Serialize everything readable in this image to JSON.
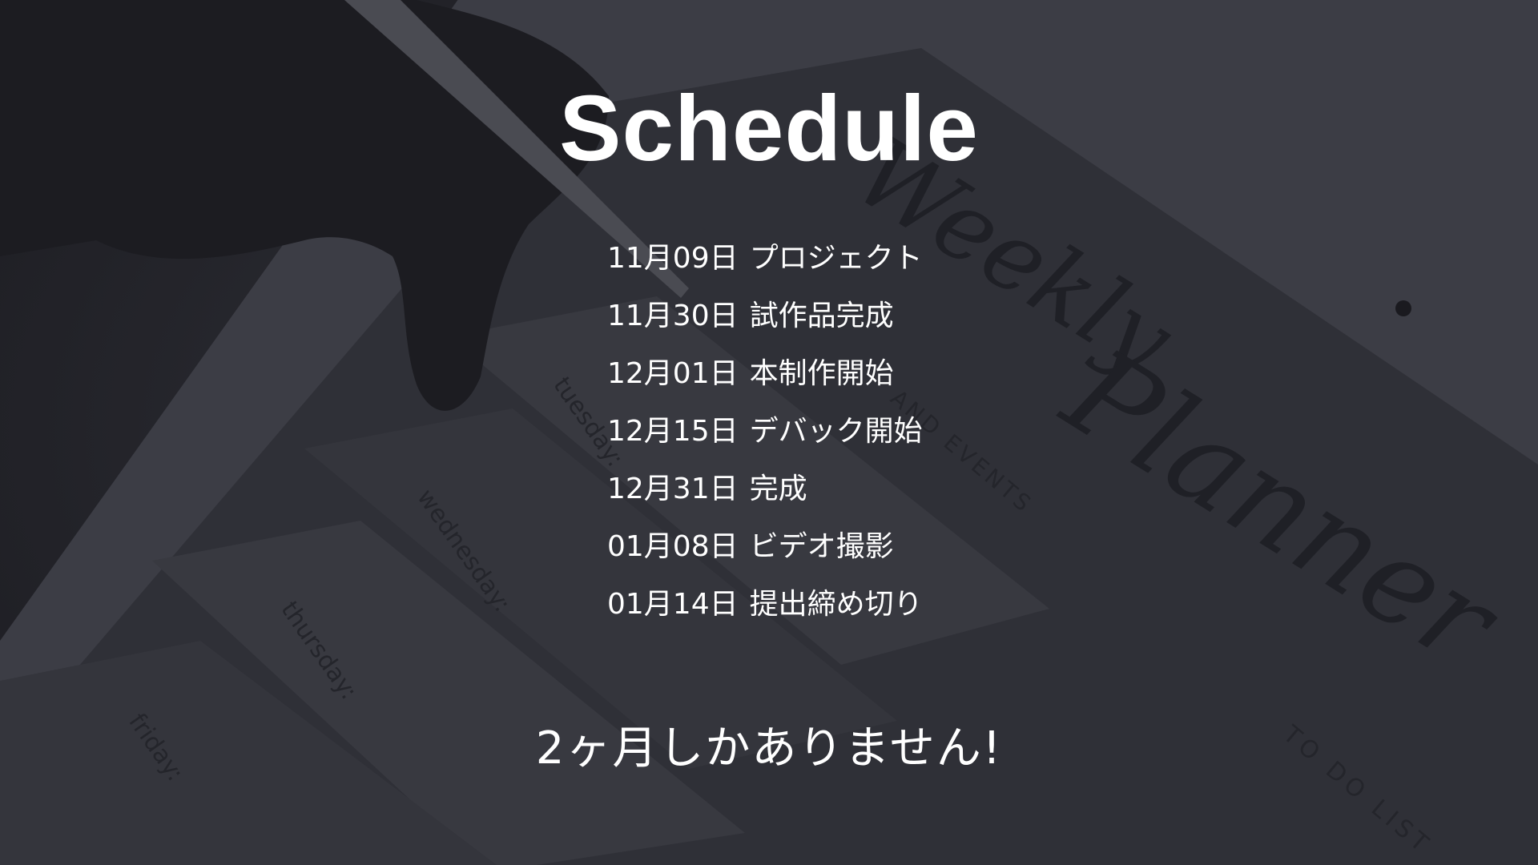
{
  "slide": {
    "title": "Schedule",
    "closing_note": "2ヶ月しかありません!"
  },
  "schedule": [
    {
      "date": "11月09日",
      "task": "プロジェクト"
    },
    {
      "date": "11月30日",
      "task": "試作品完成"
    },
    {
      "date": "12月01日",
      "task": "本制作開始"
    },
    {
      "date": "12月15日",
      "task": "デバック開始"
    },
    {
      "date": "12月31日",
      "task": "完成"
    },
    {
      "date": "01月08日",
      "task": "ビデオ撮影"
    },
    {
      "date": "01月14日",
      "task": "提出締め切り"
    }
  ],
  "background": {
    "description_icon": "tablet-planner-photo",
    "planner_title": "Weekly Planner",
    "day_labels": [
      "tuesday:",
      "wednesday:",
      "thursday:",
      "friday:"
    ],
    "section_labels": [
      "WEDNESDAY AND EVENTS",
      "TO DO LIST"
    ],
    "colors": {
      "overlay": "#24252c",
      "text": "#ffffff"
    }
  }
}
